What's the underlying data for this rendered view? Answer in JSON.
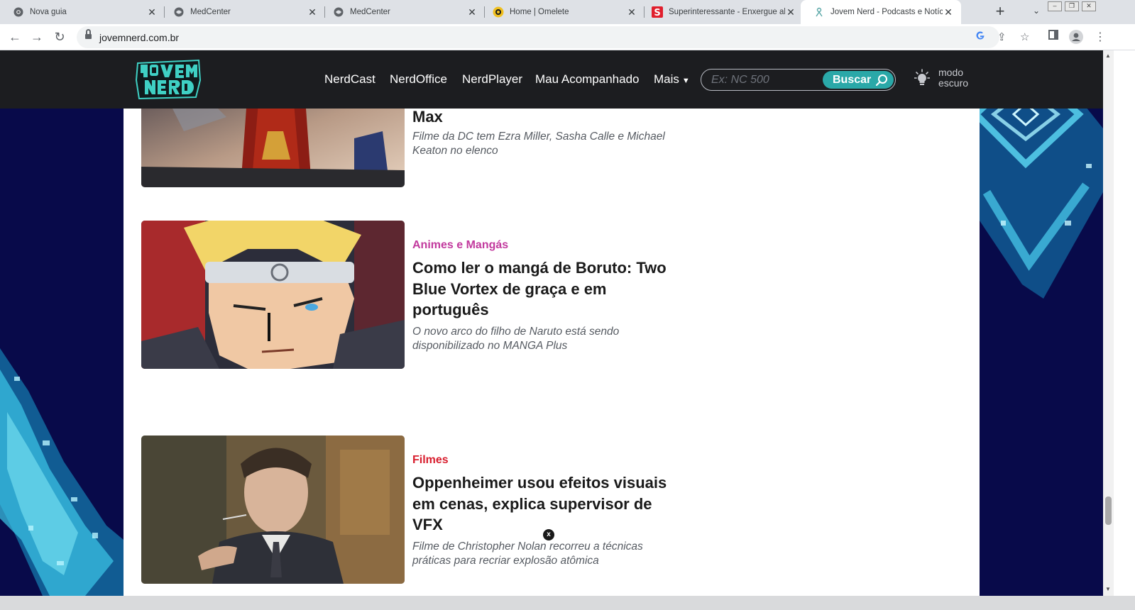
{
  "browser": {
    "tabs": [
      {
        "title": "Nova guia",
        "icon": "chrome-icon"
      },
      {
        "title": "MedCenter",
        "icon": "globe-icon"
      },
      {
        "title": "MedCenter",
        "icon": "globe-icon"
      },
      {
        "title": "Home | Omelete",
        "icon": "omelete-icon"
      },
      {
        "title": "Superinteressante - Enxergue além",
        "icon": "superinteressante-icon"
      },
      {
        "title": "Jovem Nerd - Podcasts e Notícias",
        "icon": "jovem-nerd-icon",
        "active": true
      }
    ],
    "new_tab": "+",
    "tab_search": "⌄",
    "url": "jovemnerd.com.br"
  },
  "site": {
    "nav": [
      "NerdCast",
      "NerdOffice",
      "NerdPlayer",
      "Mau Acompanhado",
      "Mais"
    ],
    "search_placeholder": "Ex: NC 500",
    "search_button": "Buscar",
    "dark_mode_line1": "modo",
    "dark_mode_line2": "escuro",
    "accent": "#2aa8a8"
  },
  "articles": [
    {
      "category": "",
      "headline": "Max",
      "excerpt": "Filme da DC tem Ezra Miller, Sasha Calle e Michael Keaton no elenco"
    },
    {
      "category": "Animes e Mangás",
      "category_color": "#c23a9e",
      "headline": "Como ler o mangá de Boruto: Two Blue Vortex de graça e em português",
      "excerpt": "O novo arco do filho de Naruto está sendo disponibilizado no MANGA Plus"
    },
    {
      "category": "Filmes",
      "category_color": "#d81e2e",
      "headline": "Oppenheimer usou efeitos visuais em cenas, explica supervisor de VFX",
      "excerpt": "Filme de Christopher Nolan recorreu a técnicas práticas para recriar explosão atômica"
    }
  ],
  "ad_close": "x"
}
